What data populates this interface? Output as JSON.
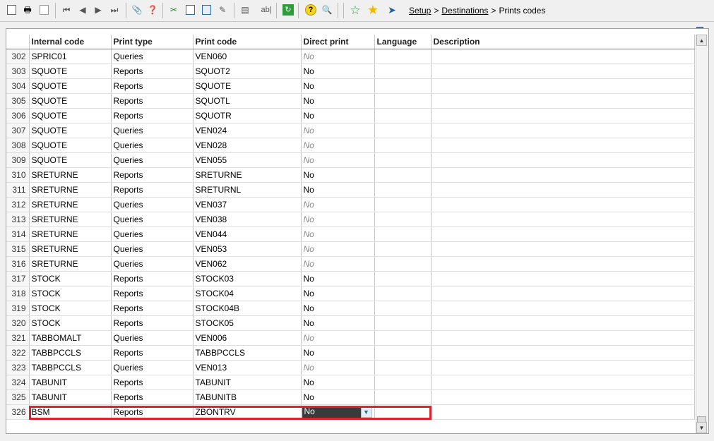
{
  "toolbar": {
    "icons": [
      "new-icon",
      "print-icon",
      "export-icon",
      "first-record-icon",
      "previous-record-icon",
      "next-record-icon",
      "last-record-icon",
      "attach-icon",
      "help-icon",
      "cut-icon",
      "copy-icon",
      "paste-icon",
      "edit-icon",
      "layout-icon",
      "text-icon",
      "refresh-icon",
      "question-icon",
      "search-icon",
      "favorite-add-icon",
      "favorite-icon",
      "signpost-icon"
    ]
  },
  "breadcrumb": {
    "items": [
      "Setup",
      "Destinations",
      "Prints codes"
    ],
    "separator": ">"
  },
  "table": {
    "columns": [
      "Internal code",
      "Print type",
      "Print code",
      "Direct print",
      "Language",
      "Description"
    ],
    "rows": [
      {
        "num": "302",
        "internal": "SPRIC01",
        "type": "Queries",
        "code": "VEN060",
        "direct": "No",
        "italic": true
      },
      {
        "num": "303",
        "internal": "SQUOTE",
        "type": "Reports",
        "code": "SQUOT2",
        "direct": "No",
        "italic": false
      },
      {
        "num": "304",
        "internal": "SQUOTE",
        "type": "Reports",
        "code": "SQUOTE",
        "direct": "No",
        "italic": false
      },
      {
        "num": "305",
        "internal": "SQUOTE",
        "type": "Reports",
        "code": "SQUOTL",
        "direct": "No",
        "italic": false
      },
      {
        "num": "306",
        "internal": "SQUOTE",
        "type": "Reports",
        "code": "SQUOTR",
        "direct": "No",
        "italic": false
      },
      {
        "num": "307",
        "internal": "SQUOTE",
        "type": "Queries",
        "code": "VEN024",
        "direct": "No",
        "italic": true
      },
      {
        "num": "308",
        "internal": "SQUOTE",
        "type": "Queries",
        "code": "VEN028",
        "direct": "No",
        "italic": true
      },
      {
        "num": "309",
        "internal": "SQUOTE",
        "type": "Queries",
        "code": "VEN055",
        "direct": "No",
        "italic": true
      },
      {
        "num": "310",
        "internal": "SRETURNE",
        "type": "Reports",
        "code": "SRETURNE",
        "direct": "No",
        "italic": false
      },
      {
        "num": "311",
        "internal": "SRETURNE",
        "type": "Reports",
        "code": "SRETURNL",
        "direct": "No",
        "italic": false
      },
      {
        "num": "312",
        "internal": "SRETURNE",
        "type": "Queries",
        "code": "VEN037",
        "direct": "No",
        "italic": true
      },
      {
        "num": "313",
        "internal": "SRETURNE",
        "type": "Queries",
        "code": "VEN038",
        "direct": "No",
        "italic": true
      },
      {
        "num": "314",
        "internal": "SRETURNE",
        "type": "Queries",
        "code": "VEN044",
        "direct": "No",
        "italic": true
      },
      {
        "num": "315",
        "internal": "SRETURNE",
        "type": "Queries",
        "code": "VEN053",
        "direct": "No",
        "italic": true
      },
      {
        "num": "316",
        "internal": "SRETURNE",
        "type": "Queries",
        "code": "VEN062",
        "direct": "No",
        "italic": true
      },
      {
        "num": "317",
        "internal": "STOCK",
        "type": "Reports",
        "code": "STOCK03",
        "direct": "No",
        "italic": false
      },
      {
        "num": "318",
        "internal": "STOCK",
        "type": "Reports",
        "code": "STOCK04",
        "direct": "No",
        "italic": false
      },
      {
        "num": "319",
        "internal": "STOCK",
        "type": "Reports",
        "code": "STOCK04B",
        "direct": "No",
        "italic": false
      },
      {
        "num": "320",
        "internal": "STOCK",
        "type": "Reports",
        "code": "STOCK05",
        "direct": "No",
        "italic": false
      },
      {
        "num": "321",
        "internal": "TABBOMALT",
        "type": "Queries",
        "code": "VEN006",
        "direct": "No",
        "italic": true
      },
      {
        "num": "322",
        "internal": "TABBPCCLS",
        "type": "Reports",
        "code": "TABBPCCLS",
        "direct": "No",
        "italic": false
      },
      {
        "num": "323",
        "internal": "TABBPCCLS",
        "type": "Queries",
        "code": "VEN013",
        "direct": "No",
        "italic": true
      },
      {
        "num": "324",
        "internal": "TABUNIT",
        "type": "Reports",
        "code": "TABUNIT",
        "direct": "No",
        "italic": false
      },
      {
        "num": "325",
        "internal": "TABUNIT",
        "type": "Reports",
        "code": "TABUNITB",
        "direct": "No",
        "italic": false
      }
    ],
    "edit_row": {
      "num": "326",
      "internal": "BSM",
      "type": "Reports",
      "code": "ZBONTRV",
      "direct": "No"
    }
  },
  "colors": {
    "highlight": "#d9232e",
    "selected_cell": "#3a3a3a"
  }
}
